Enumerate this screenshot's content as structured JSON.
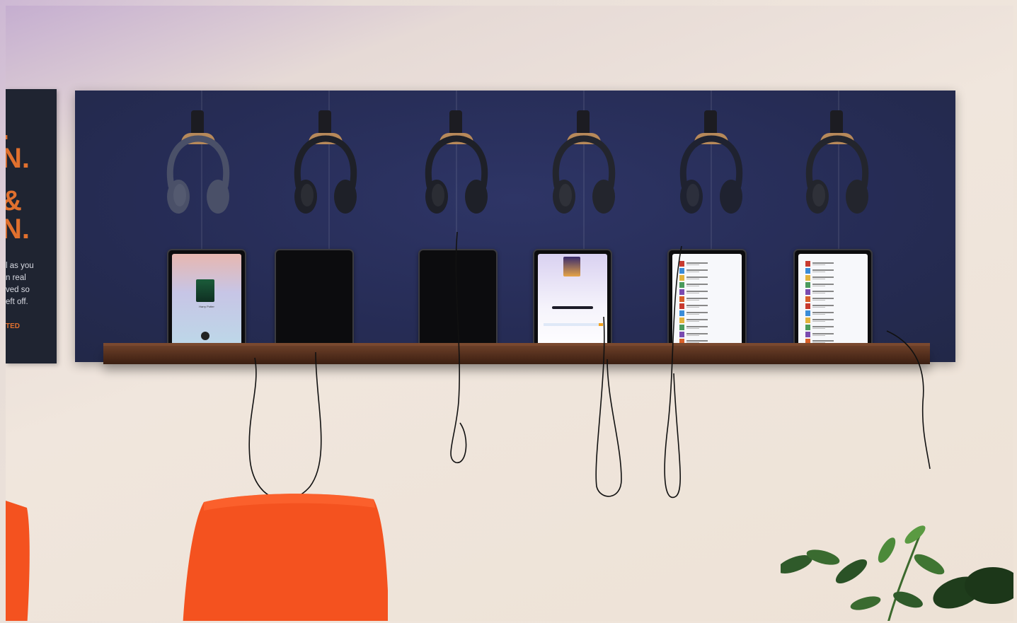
{
  "poster": {
    "big_lines": [
      ".",
      "N.",
      "&",
      "N."
    ],
    "body_lines": [
      "l as you",
      "n real",
      "ved so",
      "eft off."
    ],
    "tag": "TED"
  },
  "stations": [
    {
      "headphone_color": "#4a5068",
      "screen": "player",
      "screen_title": "Harry Potter"
    },
    {
      "headphone_color": "#1e2028",
      "screen": "off"
    },
    {
      "headphone_color": "#1e2028",
      "screen": "off"
    },
    {
      "headphone_color": "#23252d",
      "screen": "detail"
    },
    {
      "headphone_color": "#1f2230",
      "screen": "list"
    },
    {
      "headphone_color": "#23252d",
      "screen": "list"
    }
  ],
  "colors": {
    "felt": "#262c55",
    "shelf": "#4a2818",
    "chair": "#f4521f",
    "plant": "#2f5a2a",
    "wall": "#efe5dc"
  }
}
